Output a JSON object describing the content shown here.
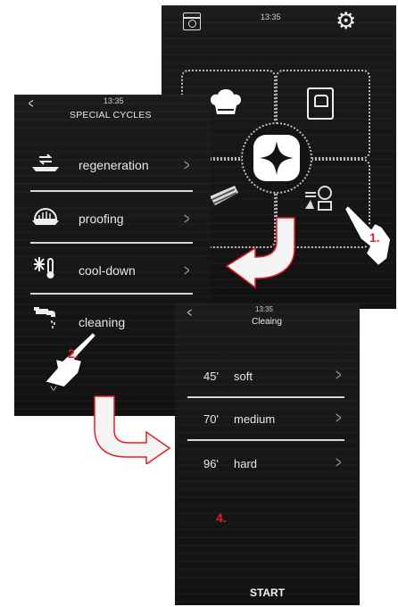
{
  "main_screen": {
    "time": "13:35"
  },
  "special_cycles": {
    "time": "13:35",
    "title": "SPECIAL CYCLES",
    "items": [
      {
        "label": "regeneration",
        "icon": "regeneration-icon"
      },
      {
        "label": "proofing",
        "icon": "proofing-icon"
      },
      {
        "label": "cool-down",
        "icon": "cool-down-icon"
      },
      {
        "label": "cleaning",
        "icon": "cleaning-icon"
      }
    ]
  },
  "cleaning_screen": {
    "time": "13:35",
    "title": "Cleaing",
    "options": [
      {
        "duration": "45'",
        "label": "soft"
      },
      {
        "duration": "70'",
        "label": "medium"
      },
      {
        "duration": "96'",
        "label": "hard"
      }
    ],
    "start_label": "START"
  },
  "steps": {
    "step1": "1.",
    "step2": "2.",
    "step4": "4."
  },
  "colors": {
    "screen_bg": "#141414",
    "text": "#e8e8e8",
    "accent_red": "#e31e24"
  }
}
